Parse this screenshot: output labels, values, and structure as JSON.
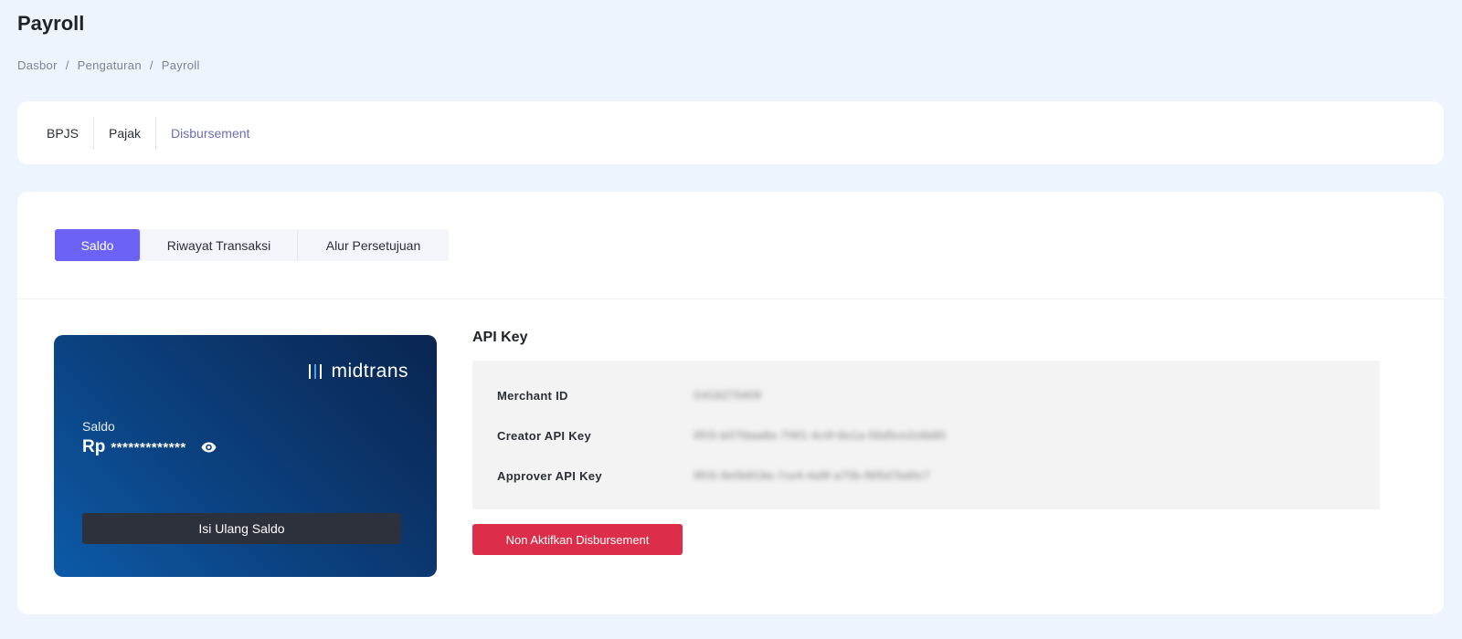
{
  "page": {
    "title": "Payroll",
    "breadcrumb": [
      "Dasbor",
      "Pengaturan",
      "Payroll"
    ]
  },
  "tabs": [
    "BPJS",
    "Pajak",
    "Disbursement"
  ],
  "active_tab": "Disbursement",
  "subtabs": [
    "Saldo",
    "Riwayat Transaksi",
    "Alur Persetujuan"
  ],
  "active_subtab": "Saldo",
  "balance_card": {
    "brand": "midtrans",
    "label": "Saldo",
    "currency": "Rp",
    "masked_amount": "*************",
    "topup_label": "Isi Ulang Saldo"
  },
  "api": {
    "title": "API Key",
    "rows": [
      {
        "label": "Merchant ID",
        "value": "G418275409"
      },
      {
        "label": "Creator API Key",
        "value": "IRIS-b07fdaa8e-7f4f1-4c4f-8e1a-56d5ce2c6b80"
      },
      {
        "label": "Approver API Key",
        "value": "IRIS-9e0b919a-7ce4-4a9f-a70b-f6f5d7bd0c7"
      }
    ]
  },
  "deactivate_label": "Non Aktifkan Disbursement",
  "colors": {
    "accent": "#6c63f6",
    "danger": "#dc2e4a",
    "card_dark": "#0a2550",
    "card_light": "#0c5aa8"
  }
}
